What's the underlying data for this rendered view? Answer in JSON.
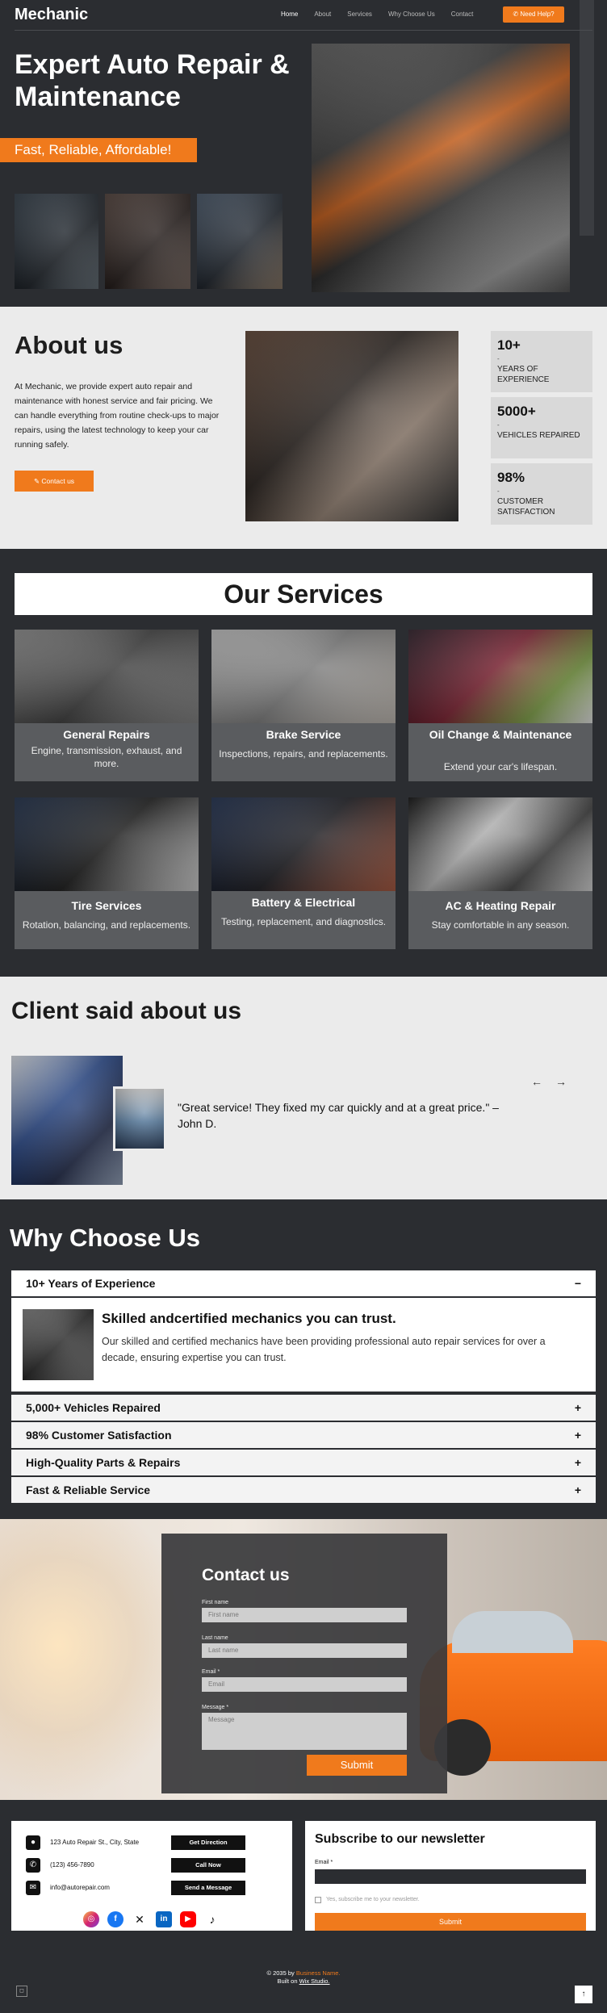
{
  "header": {
    "logo": "Mechanic",
    "nav": [
      "Home",
      "About",
      "Services",
      "Why Choose Us",
      "Contact"
    ],
    "help_button": "Need Help?"
  },
  "hero": {
    "title": "Expert Auto Repair & Maintenance",
    "tagline": "Fast, Reliable, Affordable!"
  },
  "about": {
    "title": "About us",
    "text": "At Mechanic, we provide expert auto repair and maintenance with honest service and fair pricing. We can handle everything from routine check-ups to major repairs, using the latest technology to keep your car running safely.",
    "button": "Contact us",
    "stats": [
      {
        "number": "10+",
        "dash": "-",
        "label": "YEARS OF EXPERIENCE"
      },
      {
        "number": "5000+",
        "dash": "-",
        "label": "VEHICLES REPAIRED"
      },
      {
        "number": "98%",
        "dash": "-",
        "label": "CUSTOMER SATISFACTION"
      }
    ]
  },
  "services": {
    "title": "Our Services",
    "items": [
      {
        "title": "General Repairs",
        "desc": "Engine, transmission, exhaust, and more."
      },
      {
        "title": "Brake Service",
        "desc": "Inspections, repairs, and replacements."
      },
      {
        "title": "Oil Change & Maintenance",
        "desc": "Extend your car's lifespan."
      },
      {
        "title": "Tire Services",
        "desc": "Rotation, balancing, and replacements."
      },
      {
        "title": "Battery & Electrical",
        "desc": "Testing, replacement, and diagnostics."
      },
      {
        "title": "AC & Heating Repair",
        "desc": "Stay comfortable in any season."
      }
    ]
  },
  "client": {
    "title": "Client  said about us",
    "quote": "\"Great service! They fixed my car quickly and at a great price.\" – John D.",
    "prev": "←",
    "next": "→"
  },
  "why": {
    "title": "Why Choose Us",
    "items": [
      {
        "title": "10+ Years of Experience",
        "sign": "−"
      },
      {
        "title": "5,000+ Vehicles Repaired",
        "sign": "+"
      },
      {
        "title": "98% Customer Satisfaction",
        "sign": "+"
      },
      {
        "title": "High-Quality Parts & Repairs",
        "sign": "+"
      },
      {
        "title": "Fast & Reliable Service",
        "sign": "+"
      }
    ],
    "open": {
      "heading": "Skilled andcertified mechanics you can trust.",
      "text": "Our skilled and certified mechanics have been providing professional auto repair services for over a decade, ensuring expertise you can trust."
    }
  },
  "contact": {
    "title": "Contact us",
    "first_label": "First name",
    "first_placeholder": "First name",
    "last_label": "Last name",
    "last_placeholder": "Last name",
    "email_label": "Email *",
    "email_placeholder": "Email",
    "message_label": "Message *",
    "message_placeholder": "Message",
    "submit": "Submit"
  },
  "footer": {
    "address": "123 Auto Repair St., City, State",
    "phone": "(123) 456-7890",
    "email": "info@autorepair.com",
    "btn_direction": "Get Direction",
    "btn_call": "Call Now",
    "btn_message": "Send a Message",
    "newsletter_title": "Subscribe to our newsletter",
    "newsletter_email_label": "Email *",
    "newsletter_checkbox": "Yes, subscribe me to your newsletter.",
    "newsletter_submit": "Submit",
    "copyright_prefix": "© 2035 by",
    "business_name": "Business Name.",
    "built_prefix": "Built on",
    "built_link": "Wix Studio."
  },
  "colors": {
    "accent": "#f07a1c",
    "dark": "#2b2d31",
    "light": "#ebebeb"
  }
}
